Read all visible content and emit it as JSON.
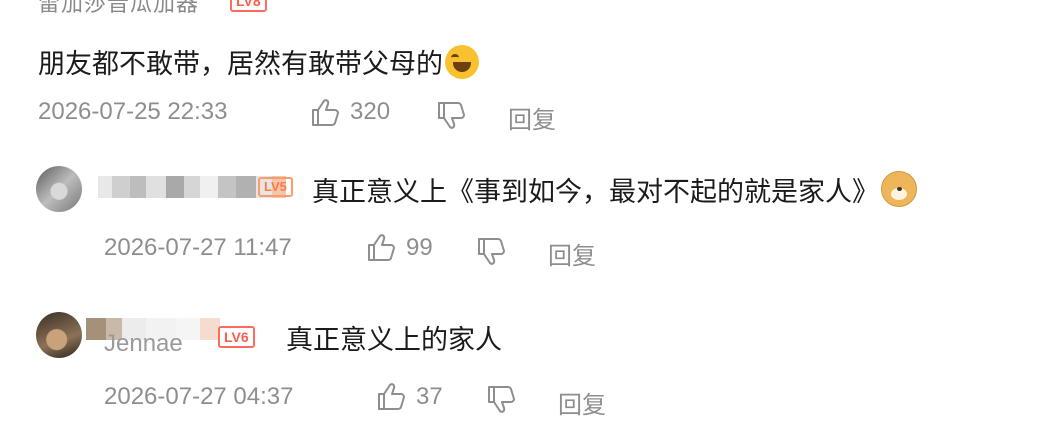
{
  "top_comment": {
    "username_partial": "雷加莎音瓜加器",
    "level_badge": "LV8",
    "text": "朋友都不敢带，居然有敢带父母的",
    "timestamp": "2026-07-25 22:33",
    "likes": "320",
    "reply_label": "回复",
    "emoji_icon": "laughing-crying-emoji"
  },
  "reply_1": {
    "level_badge": "LV5",
    "text": "真正意义上《事到如今，最对不起的就是家人》",
    "timestamp": "2026-07-27 11:47",
    "likes": "99",
    "reply_label": "回复",
    "emoji_icon": "doge-emoji"
  },
  "reply_2": {
    "username_partial": "Jennae",
    "level_badge": "LV6",
    "text": "真正意义上的家人",
    "timestamp": "2026-07-27 04:37",
    "likes": "37",
    "reply_label": "回复"
  },
  "colors": {
    "text": "#1b1b1b",
    "meta": "#8e8e8e",
    "badge": "#ff5b4f"
  }
}
